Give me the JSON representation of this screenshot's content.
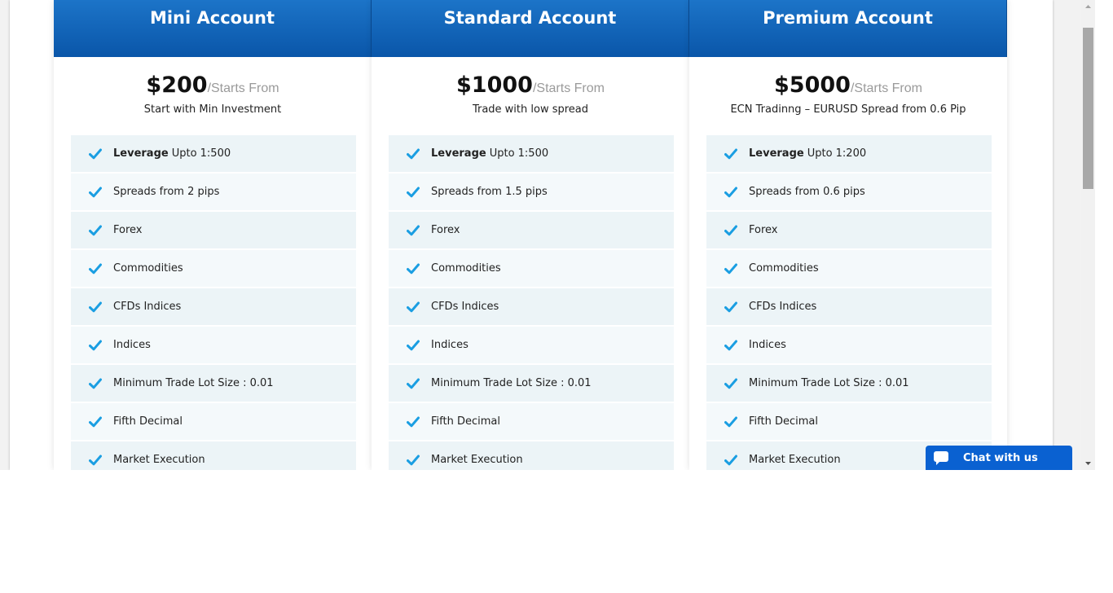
{
  "plans": [
    {
      "title": "Mini Account",
      "price": "$200",
      "price_suffix": "/Starts From",
      "subtitle": "Start with Min Investment",
      "features": [
        {
          "bold": "Leverage",
          "text": "Upto 1:500"
        },
        {
          "bold": "",
          "text": "Spreads from 2 pips"
        },
        {
          "bold": "",
          "text": "Forex"
        },
        {
          "bold": "",
          "text": "Commodities"
        },
        {
          "bold": "",
          "text": "CFDs Indices"
        },
        {
          "bold": "",
          "text": "Indices"
        },
        {
          "bold": "",
          "text": "Minimum Trade Lot Size : 0.01"
        },
        {
          "bold": "",
          "text": "Fifth Decimal"
        },
        {
          "bold": "",
          "text": "Market Execution"
        }
      ]
    },
    {
      "title": "Standard Account",
      "price": "$1000",
      "price_suffix": "/Starts From",
      "subtitle": "Trade with low spread",
      "features": [
        {
          "bold": "Leverage",
          "text": "Upto 1:500"
        },
        {
          "bold": "",
          "text": "Spreads from 1.5 pips"
        },
        {
          "bold": "",
          "text": "Forex"
        },
        {
          "bold": "",
          "text": "Commodities"
        },
        {
          "bold": "",
          "text": "CFDs Indices"
        },
        {
          "bold": "",
          "text": "Indices"
        },
        {
          "bold": "",
          "text": "Minimum Trade Lot Size : 0.01"
        },
        {
          "bold": "",
          "text": "Fifth Decimal"
        },
        {
          "bold": "",
          "text": "Market Execution"
        }
      ]
    },
    {
      "title": "Premium Account",
      "price": "$5000",
      "price_suffix": "/Starts From",
      "subtitle": "ECN Tradinng – EURUSD Spread from 0.6 Pip",
      "features": [
        {
          "bold": "Leverage",
          "text": "Upto 1:200"
        },
        {
          "bold": "",
          "text": "Spreads from 0.6 pips"
        },
        {
          "bold": "",
          "text": "Forex"
        },
        {
          "bold": "",
          "text": "Commodities"
        },
        {
          "bold": "",
          "text": "CFDs Indices"
        },
        {
          "bold": "",
          "text": "Indices"
        },
        {
          "bold": "",
          "text": "Minimum Trade Lot Size : 0.01"
        },
        {
          "bold": "",
          "text": "Fifth Decimal"
        },
        {
          "bold": "",
          "text": "Market Execution"
        }
      ]
    }
  ],
  "chat": {
    "label": "Chat with us",
    "icon": "chat-bubble-icon"
  },
  "icons": {
    "feature": "checkmark-icon"
  },
  "colors": {
    "header_blue": "#0a56a9",
    "check_blue": "#1a9ee2",
    "chat_blue": "#0a61d1"
  }
}
